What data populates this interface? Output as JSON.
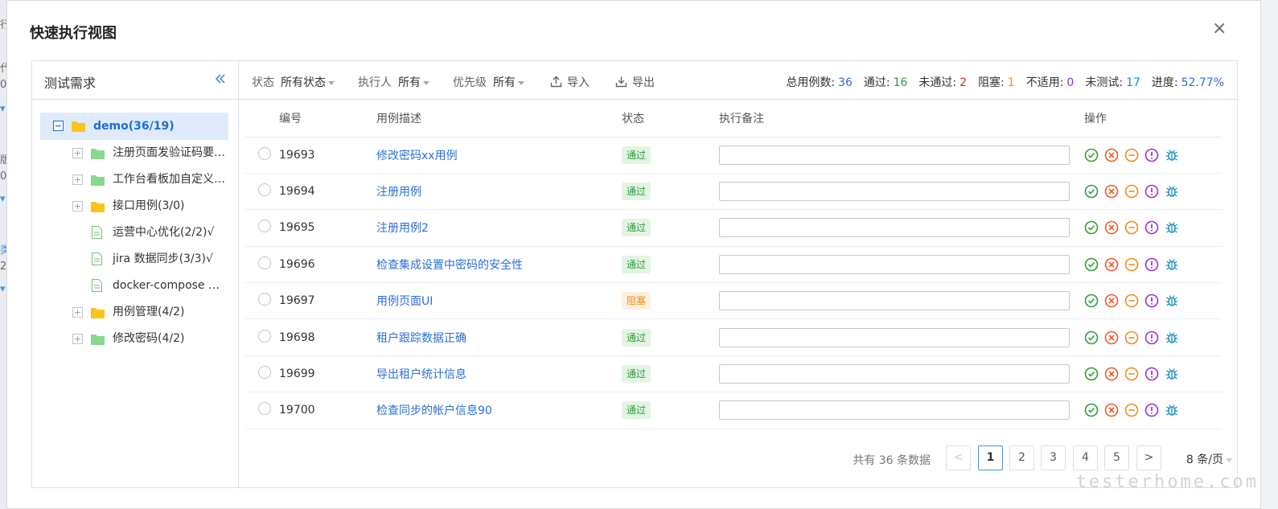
{
  "background": {
    "fragments": [
      "行",
      "代",
      "0",
      "▾",
      "版",
      "0",
      "▾",
      "类",
      "2",
      "▾"
    ]
  },
  "modal": {
    "title": "快速执行视图",
    "close": "×"
  },
  "left": {
    "title": "测试需求",
    "tree": [
      {
        "label": "demo(36/19)",
        "type": "folder",
        "color": "#fcc419",
        "expander": "−",
        "level": 0
      },
      {
        "label": "注册页面发验证码要…",
        "type": "folder",
        "color": "#8ad78e",
        "expander": "+",
        "level": 1
      },
      {
        "label": "工作台看板加自定义(…",
        "type": "folder",
        "color": "#8ad78e",
        "expander": "+",
        "level": 1
      },
      {
        "label": "接口用例(3/0)",
        "type": "folder",
        "color": "#fcc419",
        "expander": "+",
        "level": 1
      },
      {
        "label": "运营中心优化(2/2)√",
        "type": "file",
        "level": 1
      },
      {
        "label": "jira 数据同步(3/3)√",
        "type": "file",
        "level": 1
      },
      {
        "label": "docker-compose 安…",
        "type": "file",
        "level": 1
      },
      {
        "label": "用例管理(4/2)",
        "type": "folder",
        "color": "#fcc419",
        "expander": "+",
        "level": 1
      },
      {
        "label": "修改密码(4/2)",
        "type": "folder",
        "color": "#8ad78e",
        "expander": "+",
        "level": 1
      }
    ]
  },
  "toolbar": {
    "status_label": "状态",
    "status_value": "所有状态",
    "executor_label": "执行人",
    "executor_value": "所有",
    "priority_label": "优先级",
    "priority_value": "所有",
    "import_label": "导入",
    "export_label": "导出"
  },
  "stats": {
    "total_label": "总用例数:",
    "total": "36",
    "pass_label": "通过:",
    "pass": "16",
    "fail_label": "未通过:",
    "fail": "2",
    "blocked_label": "阻塞:",
    "blocked": "1",
    "na_label": "不适用:",
    "na": "0",
    "untested_label": "未测试:",
    "untested": "17",
    "progress_label": "进度:",
    "progress": "52.77%",
    "colors": {
      "total": "#2b6fd6",
      "pass": "#2e9e3e",
      "fail": "#e02020",
      "blocked": "#f08c18",
      "na": "#9b30d9",
      "untested": "#1890c8",
      "progress": "#2b6fd6"
    }
  },
  "table": {
    "headers": [
      "编号",
      "用例描述",
      "状态",
      "执行备注",
      "操作"
    ],
    "rows": [
      {
        "id": "19693",
        "desc": "修改密码xx用例",
        "status": "通过",
        "kind": "pass"
      },
      {
        "id": "19694",
        "desc": "注册用例",
        "status": "通过",
        "kind": "pass"
      },
      {
        "id": "19695",
        "desc": "注册用例2",
        "status": "通过",
        "kind": "pass"
      },
      {
        "id": "19696",
        "desc": "检查集成设置中密码的安全性",
        "status": "通过",
        "kind": "pass"
      },
      {
        "id": "19697",
        "desc": "用例页面UI",
        "status": "阻塞",
        "kind": "block"
      },
      {
        "id": "19698",
        "desc": "租户跟踪数据正确",
        "status": "通过",
        "kind": "pass"
      },
      {
        "id": "19699",
        "desc": "导出租户统计信息",
        "status": "通过",
        "kind": "pass"
      },
      {
        "id": "19700",
        "desc": "检查同步的帐户信息90",
        "status": "通过",
        "kind": "pass"
      }
    ],
    "actions": [
      {
        "name": "pass-action-icon",
        "color": "#2e9e3e"
      },
      {
        "name": "fail-action-icon",
        "color": "#f05a28"
      },
      {
        "name": "block-action-icon",
        "color": "#f08c18"
      },
      {
        "name": "na-action-icon",
        "color": "#9b30d9"
      },
      {
        "name": "bug-action-icon",
        "color": "#1890c8"
      }
    ]
  },
  "pagination": {
    "total_text": "共有 36 条数据",
    "prev": "<",
    "pages": [
      "1",
      "2",
      "3",
      "4",
      "5"
    ],
    "current": "1",
    "next": ">",
    "page_size": "8 条/页"
  },
  "watermark": "testerhome.com"
}
